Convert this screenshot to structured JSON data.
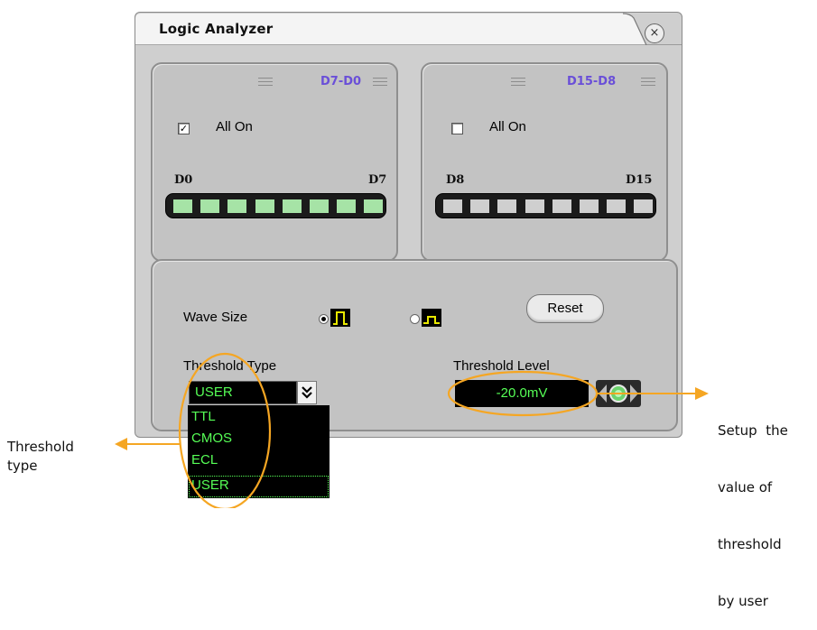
{
  "dialog": {
    "title": "Logic Analyzer",
    "close_glyph": "×"
  },
  "group_low": {
    "title": "D7-D0",
    "all_on_label": "All On",
    "all_on_checked": true,
    "first_label": "D0",
    "last_label": "D7",
    "channel_states": [
      true,
      true,
      true,
      true,
      true,
      true,
      true,
      true
    ],
    "on_color": "#a6e3a6"
  },
  "group_high": {
    "title": "D15-D8",
    "all_on_label": "All On",
    "all_on_checked": false,
    "first_label": "D8",
    "last_label": "D15",
    "channel_states": [
      false,
      false,
      false,
      false,
      false,
      false,
      false,
      false
    ],
    "off_color": "#cfcfcf"
  },
  "settings": {
    "wave_size_label": "Wave Size",
    "wave_size_selected": "large",
    "reset_label": "Reset",
    "threshold_type_label": "Threshold Type",
    "threshold_type_value": "USER",
    "threshold_type_options": [
      "TTL",
      "CMOS",
      "ECL",
      "USER"
    ],
    "threshold_level_label": "Threshold Level",
    "threshold_level_value": "-20.0mV"
  },
  "annotations": {
    "left_lines": [
      "Threshold",
      "type"
    ],
    "right_lines": [
      "Setup  the",
      "value of",
      "threshold",
      "by user"
    ],
    "highlight_color": "#f5a623"
  },
  "icons": [
    "menu-lines-icon",
    "list-icon",
    "close-icon",
    "checkbox-icon",
    "double-chevron-down-icon",
    "radio-icon",
    "wave-large-icon",
    "wave-small-icon",
    "left-arrow-icon",
    "right-arrow-icon",
    "knob-icon"
  ]
}
